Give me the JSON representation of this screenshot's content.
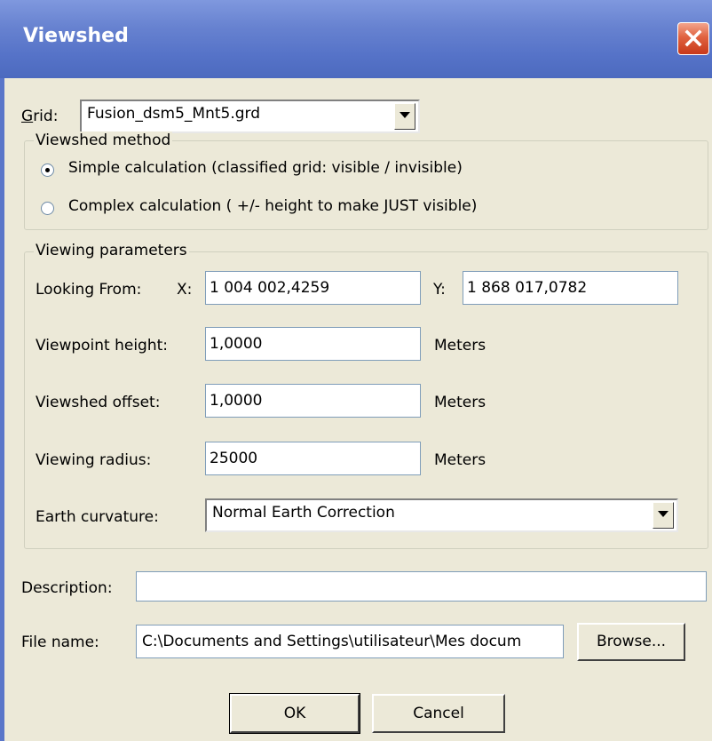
{
  "window": {
    "title": "Viewshed"
  },
  "grid": {
    "label": "Grid:",
    "value": "Fusion_dsm5_Mnt5.grd"
  },
  "viewshed_method": {
    "title": "Viewshed method",
    "options": [
      {
        "label": "Simple calculation (classified grid: visible / invisible)",
        "selected": true
      },
      {
        "label": "Complex calculation ( +/- height to make JUST visible)",
        "selected": false
      }
    ]
  },
  "viewing_parameters": {
    "title": "Viewing parameters",
    "looking_from_label": "Looking From:",
    "x_label": "X:",
    "x_value": "1 004 002,4259",
    "y_label": "Y:",
    "y_value": "1 868 017,0782",
    "viewpoint_height": {
      "label": "Viewpoint height:",
      "value": "1,0000",
      "unit": "Meters"
    },
    "viewshed_offset": {
      "label": "Viewshed offset:",
      "value": "1,0000",
      "unit": "Meters"
    },
    "viewing_radius": {
      "label": "Viewing radius:",
      "value": "25000",
      "unit": "Meters"
    },
    "earth_curvature": {
      "label": "Earth curvature:",
      "value": "Normal Earth Correction"
    }
  },
  "description": {
    "label": "Description:",
    "value": ""
  },
  "file_name": {
    "label": "File name:",
    "value": "C:\\Documents and Settings\\utilisateur\\Mes docum"
  },
  "buttons": {
    "browse": "Browse...",
    "ok": "OK",
    "cancel": "Cancel"
  },
  "colors": {
    "titlebar": "#6782d0",
    "dialog_bg": "#ece9d8",
    "close": "#d9532f"
  }
}
